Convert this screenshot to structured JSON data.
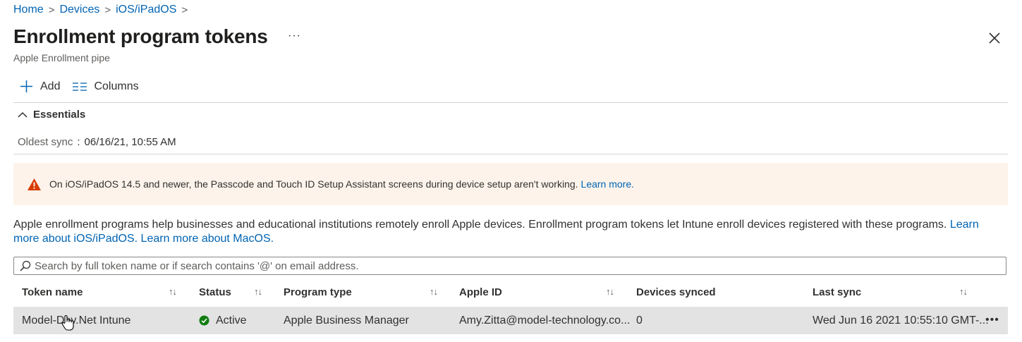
{
  "breadcrumb": {
    "items": [
      "Home",
      "Devices",
      "iOS/iPadOS"
    ],
    "separator": ">"
  },
  "header": {
    "title": "Enrollment program tokens",
    "more": "···",
    "subtitle": "Apple Enrollment pipe"
  },
  "toolbar": {
    "add_label": "Add",
    "columns_label": "Columns"
  },
  "essentials": {
    "label": "Essentials",
    "oldest_sync_label": "Oldest sync",
    "separator": ":",
    "oldest_sync_value": "06/16/21, 10:55 AM"
  },
  "banner": {
    "text": "On iOS/iPadOS 14.5 and newer, the Passcode and Touch ID Setup Assistant screens during device setup aren't working.",
    "link": "Learn more."
  },
  "description": {
    "text": "Apple enrollment programs help businesses and educational institutions remotely enroll Apple devices. Enrollment program tokens let Intune enroll devices registered with these programs.",
    "link_ios": "Learn more about iOS/iPadOS.",
    "link_macos": "Learn more about MacOS."
  },
  "search": {
    "placeholder": "Search by full token name or if search contains '@' on email address."
  },
  "table": {
    "columns": [
      "Token name",
      "Status",
      "Program type",
      "Apple ID",
      "Devices synced",
      "Last sync"
    ],
    "sort_glyph": "↑↓",
    "rows": [
      {
        "token_name": "Model-Dev.Net Intune",
        "status": "Active",
        "program_type": "Apple Business Manager",
        "apple_id": "Amy.Zitta@model-technology.co...",
        "devices_synced": "0",
        "last_sync": "Wed Jun 16 2021 10:55:10 GMT-...",
        "more": "•••"
      }
    ]
  },
  "colors": {
    "link": "#0064b4",
    "warning_bg": "#fdf3ea",
    "warning_icon": "#d83b01",
    "status_active": "#107c10",
    "row_selected": "#e3e3e3"
  }
}
